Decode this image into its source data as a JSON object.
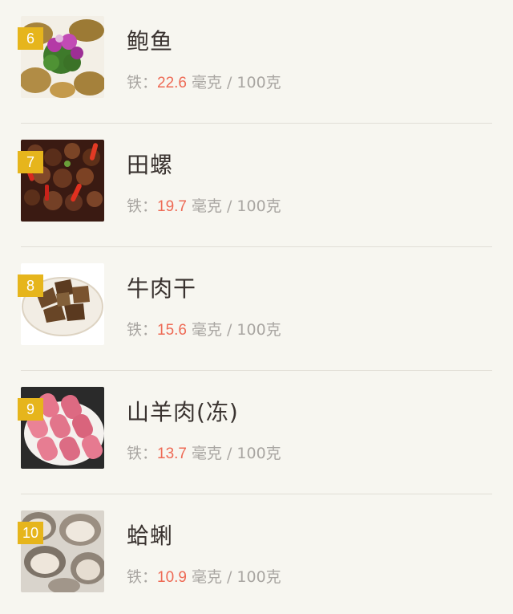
{
  "iron_label": "铁：",
  "unit": "毫克",
  "separator": "/",
  "per": "100克",
  "items": [
    {
      "rank": "6",
      "name": "鲍鱼",
      "value": "22.6",
      "image": "abalone-plate"
    },
    {
      "rank": "7",
      "name": "田螺",
      "value": "19.7",
      "image": "river-snails-with-chili"
    },
    {
      "rank": "8",
      "name": "牛肉干",
      "value": "15.6",
      "image": "beef-jerky-plate"
    },
    {
      "rank": "9",
      "name": "山羊肉(冻)",
      "value": "13.7",
      "image": "frozen-mutton-rolls"
    },
    {
      "rank": "10",
      "name": "蛤蜊",
      "value": "10.9",
      "image": "clams"
    }
  ],
  "colors": {
    "background": "#f7f6f0",
    "badge": "#e6b51c",
    "value": "#ee6a55",
    "title": "#3a3330",
    "muted": "#a9a6a2"
  }
}
